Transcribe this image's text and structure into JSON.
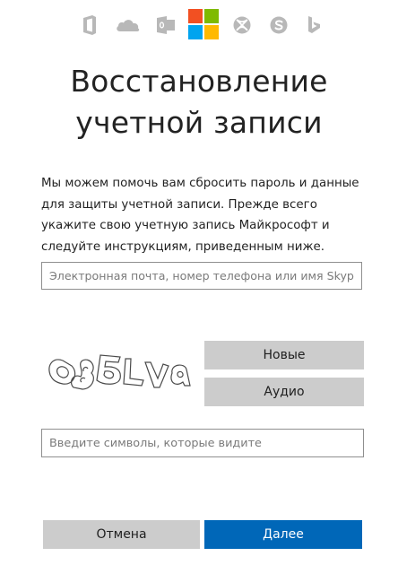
{
  "brand_bar": {
    "icons": [
      "office-icon",
      "onedrive-icon",
      "outlook-icon",
      "microsoft-logo",
      "xbox-icon",
      "skype-icon",
      "bing-icon"
    ],
    "logo_colors": [
      "#f25022",
      "#7fba00",
      "#00a4ef",
      "#ffb900"
    ]
  },
  "title": {
    "line1": "Восстановление",
    "line2": "учетной записи"
  },
  "intro_text": "Мы можем помочь вам сбросить пароль и данные для защиты учетной записи. Прежде всего укажите свою учетную запись Майкрософт и следуйте инструкциям, приведенным ниже.",
  "account_field": {
    "placeholder": "Электронная почта, номер телефона или имя Skype",
    "value": ""
  },
  "captcha": {
    "new_label": "Новые",
    "audio_label": "Аудио",
    "input_placeholder": "Введите символы, которые видите",
    "input_value": ""
  },
  "actions": {
    "cancel_label": "Отмена",
    "next_label": "Далее"
  },
  "colors": {
    "accent": "#0067b8",
    "gray_button": "#cccccc",
    "icon_gray": "#b8b8b8"
  }
}
